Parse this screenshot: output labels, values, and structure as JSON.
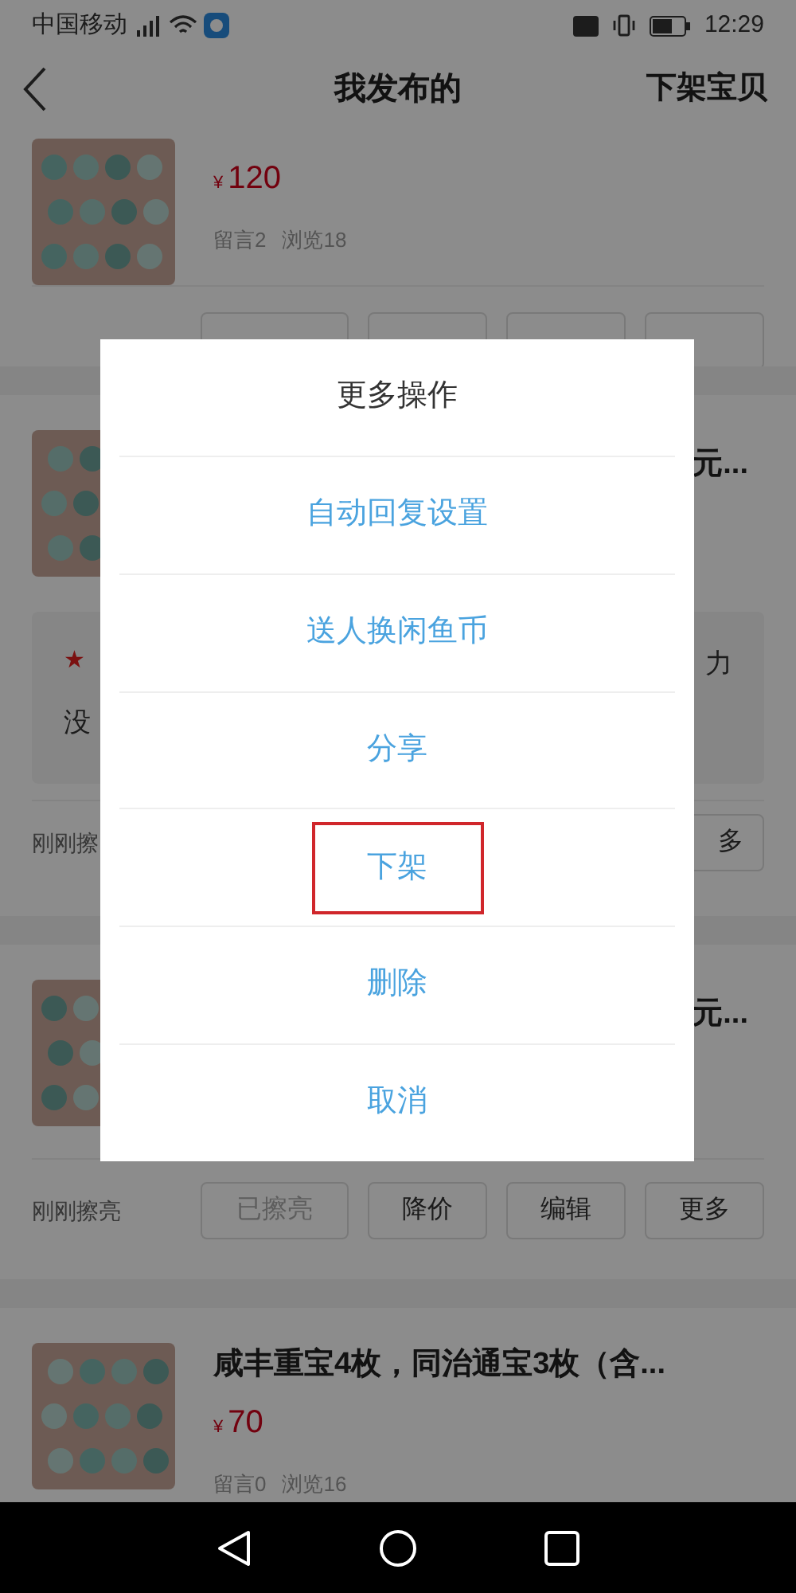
{
  "status_bar": {
    "carrier": "中国移动",
    "time": "12:29"
  },
  "header": {
    "title": "我发布的",
    "action": "下架宝贝"
  },
  "listings": [
    {
      "price_symbol": "¥",
      "price": "120",
      "comments": "留言2",
      "views": "浏览18"
    },
    {
      "title": "元...",
      "notice": {
        "star": "★",
        "left": "没",
        "right": "力"
      },
      "refreshed": "刚刚擦",
      "actions": [
        {
          "label": "多",
          "disabled": false
        }
      ]
    },
    {
      "title": "元...",
      "refreshed": "刚刚擦亮",
      "actions": [
        {
          "label": "已擦亮",
          "disabled": true
        },
        {
          "label": "降价",
          "disabled": false
        },
        {
          "label": "编辑",
          "disabled": false
        },
        {
          "label": "更多",
          "disabled": false
        }
      ]
    },
    {
      "title": "咸丰重宝4枚，同治通宝3枚（含...",
      "price_symbol": "¥",
      "price": "70",
      "comments": "留言0",
      "views": "浏览16"
    }
  ],
  "dialog": {
    "title": "更多操作",
    "options": [
      {
        "label": "自动回复设置",
        "highlighted": false
      },
      {
        "label": "送人换闲鱼币",
        "highlighted": false
      },
      {
        "label": "分享",
        "highlighted": false
      },
      {
        "label": "下架",
        "highlighted": true
      },
      {
        "label": "删除",
        "highlighted": false
      },
      {
        "label": "取消",
        "highlighted": false
      }
    ]
  }
}
